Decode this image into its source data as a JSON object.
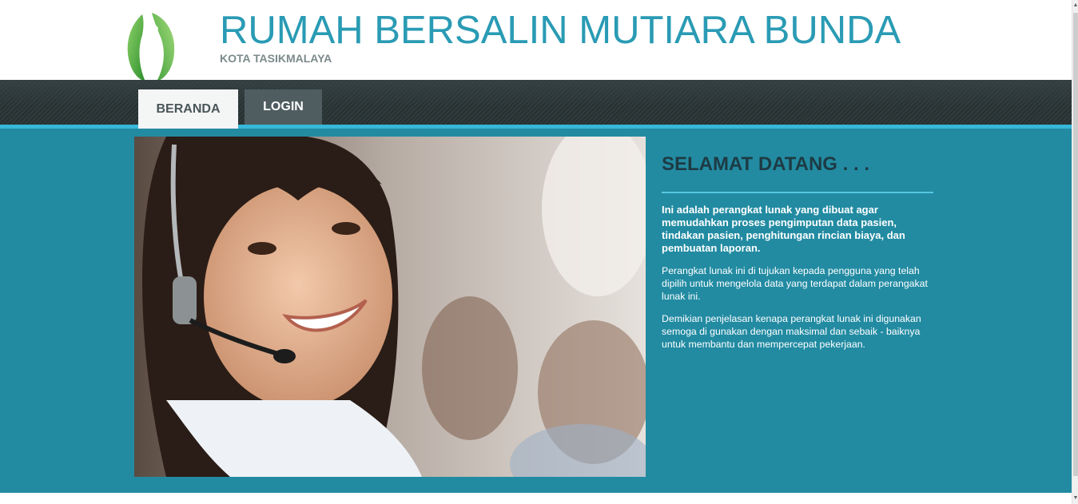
{
  "header": {
    "title": "RUMAH BERSALIN MUTIARA BUNDA",
    "subtitle": "KOTA TASIKMALAYA",
    "logo_icon": "leaf-logo-icon"
  },
  "nav": {
    "tabs": [
      {
        "label": "BERANDA",
        "active": true
      },
      {
        "label": "LOGIN",
        "active": false
      }
    ]
  },
  "main": {
    "hero_image": "call-center-woman-headset-photo",
    "welcome_title": "SELAMAT DATANG . . .",
    "paragraphs": [
      "Ini adalah perangkat lunak yang dibuat agar memudahkan proses pengimputan data pasien, tindakan pasien, penghitungan rincian biaya, dan pembuatan laporan.",
      "Perangkat lunak ini di tujukan kepada pengguna yang telah dipilih untuk mengelola data yang terdapat dalam perangakat lunak ini.",
      "Demikian penjelasan kenapa perangkat lunak ini digunakan semoga di gunakan dengan maksimal dan sebaik - baiknya untuk membantu dan mempercepat pekerjaan."
    ]
  },
  "colors": {
    "title": "#2a9bb4",
    "nav_accent": "#36b8d8",
    "main_bg": "#228ba2",
    "welcome_title": "#1d3b44"
  }
}
